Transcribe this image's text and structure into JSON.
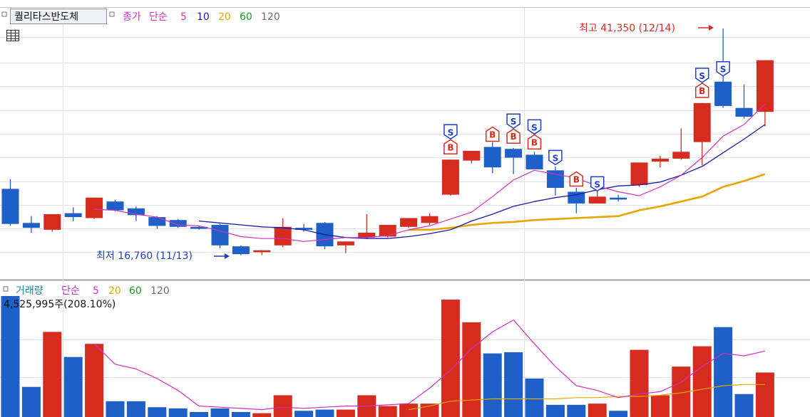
{
  "price_panel": {
    "stock_name": "퀄리타스반도체",
    "price_label": "종가",
    "ma_type": "단순",
    "ma_periods": [
      "5",
      "10",
      "20",
      "60",
      "120"
    ],
    "ma_colors": [
      "#d030c0",
      "#1a1aa8",
      "#e8a500",
      "#18a020",
      "#707070"
    ],
    "high_annotation": "최고 41,350 (12/14)",
    "low_annotation": "최저 16,760 (11/13)"
  },
  "volume_panel": {
    "title": "거래량",
    "ma_type": "단순",
    "ma_periods": [
      "5",
      "20",
      "60",
      "120"
    ],
    "ma_colors": [
      "#d030c0",
      "#e8a500",
      "#18a020",
      "#707070"
    ],
    "current_value": "4,525,995주(208.10%)"
  },
  "colors": {
    "up": "#d62b1f",
    "down": "#1f5fc8",
    "grid": "#dde2ea",
    "signal": "#ffffff"
  },
  "chart_data": {
    "type": "candlestick",
    "y_range": [
      15800,
      43400
    ],
    "candles": [
      {
        "o": 24900,
        "h": 25900,
        "l": 21100,
        "c": 21300,
        "vol": 100
      },
      {
        "o": 21400,
        "h": 22100,
        "l": 20400,
        "c": 20900,
        "vol": 24
      },
      {
        "o": 20700,
        "h": 22000,
        "l": 20500,
        "c": 22300,
        "vol": 70
      },
      {
        "o": 22400,
        "h": 23000,
        "l": 21600,
        "c": 22000,
        "vol": 49
      },
      {
        "o": 21900,
        "h": 24000,
        "l": 21800,
        "c": 24000,
        "vol": 60
      },
      {
        "o": 23600,
        "h": 23800,
        "l": 22600,
        "c": 22700,
        "vol": 12
      },
      {
        "o": 22900,
        "h": 23100,
        "l": 21600,
        "c": 22200,
        "vol": 12
      },
      {
        "o": 22000,
        "h": 22100,
        "l": 20800,
        "c": 21100,
        "vol": 7
      },
      {
        "o": 21700,
        "h": 21800,
        "l": 20900,
        "c": 21000,
        "vol": 6
      },
      {
        "o": 21000,
        "h": 21100,
        "l": 20700,
        "c": 20800,
        "vol": 3
      },
      {
        "o": 21200,
        "h": 21300,
        "l": 18800,
        "c": 19100,
        "vol": 6
      },
      {
        "o": 19000,
        "h": 19100,
        "l": 18100,
        "c": 18200,
        "vol": 3
      },
      {
        "o": 18400,
        "h": 18600,
        "l": 18100,
        "c": 18600,
        "vol": 2
      },
      {
        "o": 19100,
        "h": 21900,
        "l": 18900,
        "c": 21000,
        "vol": 17
      },
      {
        "o": 20900,
        "h": 21300,
        "l": 20500,
        "c": 20700,
        "vol": 4
      },
      {
        "o": 21400,
        "h": 21500,
        "l": 18700,
        "c": 19000,
        "vol": 5
      },
      {
        "o": 19100,
        "h": 19400,
        "l": 18300,
        "c": 19500,
        "vol": 5
      },
      {
        "o": 19900,
        "h": 22300,
        "l": 19800,
        "c": 20400,
        "vol": 17
      },
      {
        "o": 20000,
        "h": 21200,
        "l": 19900,
        "c": 21200,
        "vol": 8
      },
      {
        "o": 21000,
        "h": 21900,
        "l": 20900,
        "c": 21900,
        "vol": 10
      },
      {
        "o": 21400,
        "h": 22400,
        "l": 21200,
        "c": 22100,
        "vol": 10
      },
      {
        "o": 24300,
        "h": 26100,
        "l": 24200,
        "c": 27900,
        "vol": 97
      },
      {
        "o": 27800,
        "h": 28300,
        "l": 27500,
        "c": 28800,
        "vol": 78
      },
      {
        "o": 29200,
        "h": 29700,
        "l": 26500,
        "c": 27100,
        "vol": 52
      },
      {
        "o": 29000,
        "h": 29100,
        "l": 26400,
        "c": 28100,
        "vol": 53
      },
      {
        "o": 28400,
        "h": 28700,
        "l": 27400,
        "c": 26900,
        "vol": 31
      },
      {
        "o": 26800,
        "h": 27200,
        "l": 24200,
        "c": 25000,
        "vol": 9
      },
      {
        "o": 24600,
        "h": 25000,
        "l": 22400,
        "c": 23400,
        "vol": 9
      },
      {
        "o": 23400,
        "h": 25400,
        "l": 23400,
        "c": 24100,
        "vol": 10
      },
      {
        "o": 24000,
        "h": 24300,
        "l": 23600,
        "c": 23800,
        "vol": 4
      },
      {
        "o": 25300,
        "h": 27100,
        "l": 25100,
        "c": 27600,
        "vol": 55
      },
      {
        "o": 27700,
        "h": 28300,
        "l": 27100,
        "c": 28000,
        "vol": 17
      },
      {
        "o": 28000,
        "h": 31100,
        "l": 27900,
        "c": 28700,
        "vol": 41
      },
      {
        "o": 29700,
        "h": 32100,
        "l": 27300,
        "c": 33700,
        "vol": 58
      },
      {
        "o": 35900,
        "h": 41350,
        "l": 33200,
        "c": 33400,
        "vol": 74
      },
      {
        "o": 33200,
        "h": 35600,
        "l": 32100,
        "c": 32300,
        "vol": 18
      },
      {
        "o": 32800,
        "h": 33200,
        "l": 31300,
        "c": 38100,
        "vol": 36
      }
    ],
    "ma5": [
      null,
      null,
      null,
      null,
      22800,
      22700,
      22300,
      22000,
      21200,
      21100,
      20600,
      20000,
      19800,
      19800,
      19500,
      19700,
      19900,
      19900,
      20100,
      20700,
      21100,
      21800,
      22500,
      24100,
      25800,
      26800,
      26400,
      26000,
      25200,
      24600,
      24200,
      25100,
      26300,
      28100,
      30300,
      31500,
      33600
    ],
    "ma10": [
      null,
      null,
      null,
      null,
      null,
      null,
      null,
      null,
      null,
      21600,
      21400,
      21200,
      21000,
      20900,
      20700,
      20200,
      19900,
      19800,
      19800,
      20000,
      20300,
      20700,
      21600,
      22300,
      23100,
      23600,
      24000,
      24300,
      24800,
      25200,
      25300,
      25600,
      26300,
      27200,
      28600,
      30000,
      31500
    ],
    "ma20": [
      null,
      null,
      null,
      null,
      null,
      null,
      null,
      null,
      null,
      null,
      null,
      null,
      null,
      null,
      null,
      null,
      null,
      null,
      null,
      20700,
      20700,
      20900,
      21200,
      21400,
      21500,
      21700,
      21800,
      21900,
      22000,
      22100,
      22700,
      23100,
      23600,
      24100,
      25100,
      25700,
      26400
    ],
    "vol_ma5": [
      null,
      null,
      null,
      null,
      60,
      43,
      39,
      31,
      21,
      8,
      7,
      6,
      5,
      7,
      6,
      7,
      8,
      8,
      9,
      10,
      23,
      38,
      56,
      70,
      80,
      60,
      41,
      25,
      21,
      15,
      18,
      20,
      28,
      41,
      52,
      50,
      54
    ],
    "vol_ma20": [
      null,
      null,
      null,
      null,
      null,
      null,
      null,
      null,
      null,
      null,
      null,
      null,
      null,
      null,
      null,
      null,
      null,
      null,
      null,
      5,
      8,
      12,
      13,
      14,
      14,
      14,
      14,
      15,
      15,
      16,
      16,
      17,
      19,
      22,
      25,
      26,
      26
    ],
    "signals": [
      {
        "i": 21,
        "labels": [
          "S",
          "B"
        ]
      },
      {
        "i": 23,
        "labels": [
          "B"
        ]
      },
      {
        "i": 24,
        "labels": [
          "S",
          "B"
        ]
      },
      {
        "i": 25,
        "labels": [
          "S",
          "B"
        ]
      },
      {
        "i": 26,
        "labels": [
          "S"
        ]
      },
      {
        "i": 27,
        "labels": [
          "B"
        ]
      },
      {
        "i": 28,
        "labels": [
          "S"
        ]
      },
      {
        "i": 33,
        "labels": [
          "S",
          "B"
        ]
      },
      {
        "i": 34,
        "labels": [
          "S"
        ]
      }
    ]
  }
}
